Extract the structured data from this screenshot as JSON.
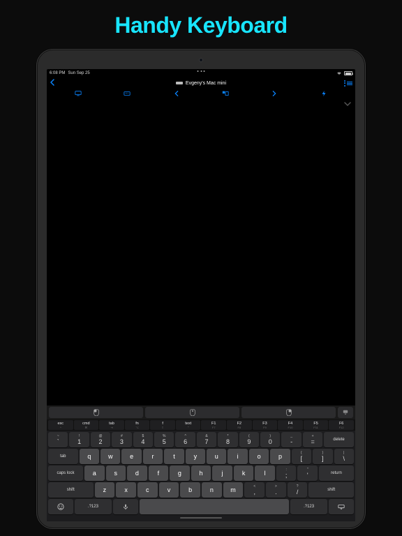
{
  "title": "Handy Keyboard",
  "status": {
    "time": "6:08 PM",
    "date": "Sun Sep 25"
  },
  "nav": {
    "deviceName": "Evgeny's Mac mini"
  },
  "fnRow": [
    {
      "top": "esc",
      "sub": "^"
    },
    {
      "top": "cmd",
      "sub": "⌘",
      "isIcon": true
    },
    {
      "top": "tab",
      "sub": "⇥"
    },
    {
      "top": "fn",
      "sub": "⌥"
    },
    {
      "top": "f",
      "sub": "⇧",
      "isIcon": true
    },
    {
      "top": "text",
      "sub": "⌃"
    },
    {
      "top": "F1",
      "sub": "F7"
    },
    {
      "top": "F2",
      "sub": "F8"
    },
    {
      "top": "F3",
      "sub": "F9"
    },
    {
      "top": "F4",
      "sub": "F10"
    },
    {
      "top": "F5",
      "sub": "F11"
    },
    {
      "top": "F6",
      "sub": "F12"
    }
  ],
  "row1": [
    {
      "a": "~",
      "m": "`"
    },
    {
      "a": "!",
      "m": "1"
    },
    {
      "a": "@",
      "m": "2"
    },
    {
      "a": "#",
      "m": "3"
    },
    {
      "a": "$",
      "m": "4"
    },
    {
      "a": "%",
      "m": "5"
    },
    {
      "a": "^",
      "m": "6"
    },
    {
      "a": "&",
      "m": "7"
    },
    {
      "a": "*",
      "m": "8"
    },
    {
      "a": "(",
      "m": "9"
    },
    {
      "a": ")",
      "m": "0"
    },
    {
      "a": "_",
      "m": "-"
    },
    {
      "a": "+",
      "m": "="
    }
  ],
  "row1_del": "delete",
  "row2_tab": "tab",
  "row2": [
    "q",
    "w",
    "e",
    "r",
    "t",
    "y",
    "u",
    "i",
    "o",
    "p"
  ],
  "row2_end": [
    {
      "a": "{",
      "m": "["
    },
    {
      "a": "}",
      "m": "]"
    },
    {
      "a": "|",
      "m": "\\"
    }
  ],
  "row3_caps": "caps lock",
  "row3": [
    "a",
    "s",
    "d",
    "f",
    "g",
    "h",
    "j",
    "k",
    "l"
  ],
  "row3_end": [
    {
      "a": ":",
      "m": ";"
    },
    {
      "a": "\"",
      "m": "'"
    }
  ],
  "row3_ret": "return",
  "row4_shift": "shift",
  "row4": [
    "z",
    "x",
    "c",
    "v",
    "b",
    "n",
    "m"
  ],
  "row4_end": [
    {
      "a": "<",
      "m": ","
    },
    {
      "a": ">",
      "m": "."
    },
    {
      "a": "?",
      "m": "/"
    }
  ],
  "row4_shift2": "shift",
  "bottom": {
    "numToggle": ".?123"
  }
}
